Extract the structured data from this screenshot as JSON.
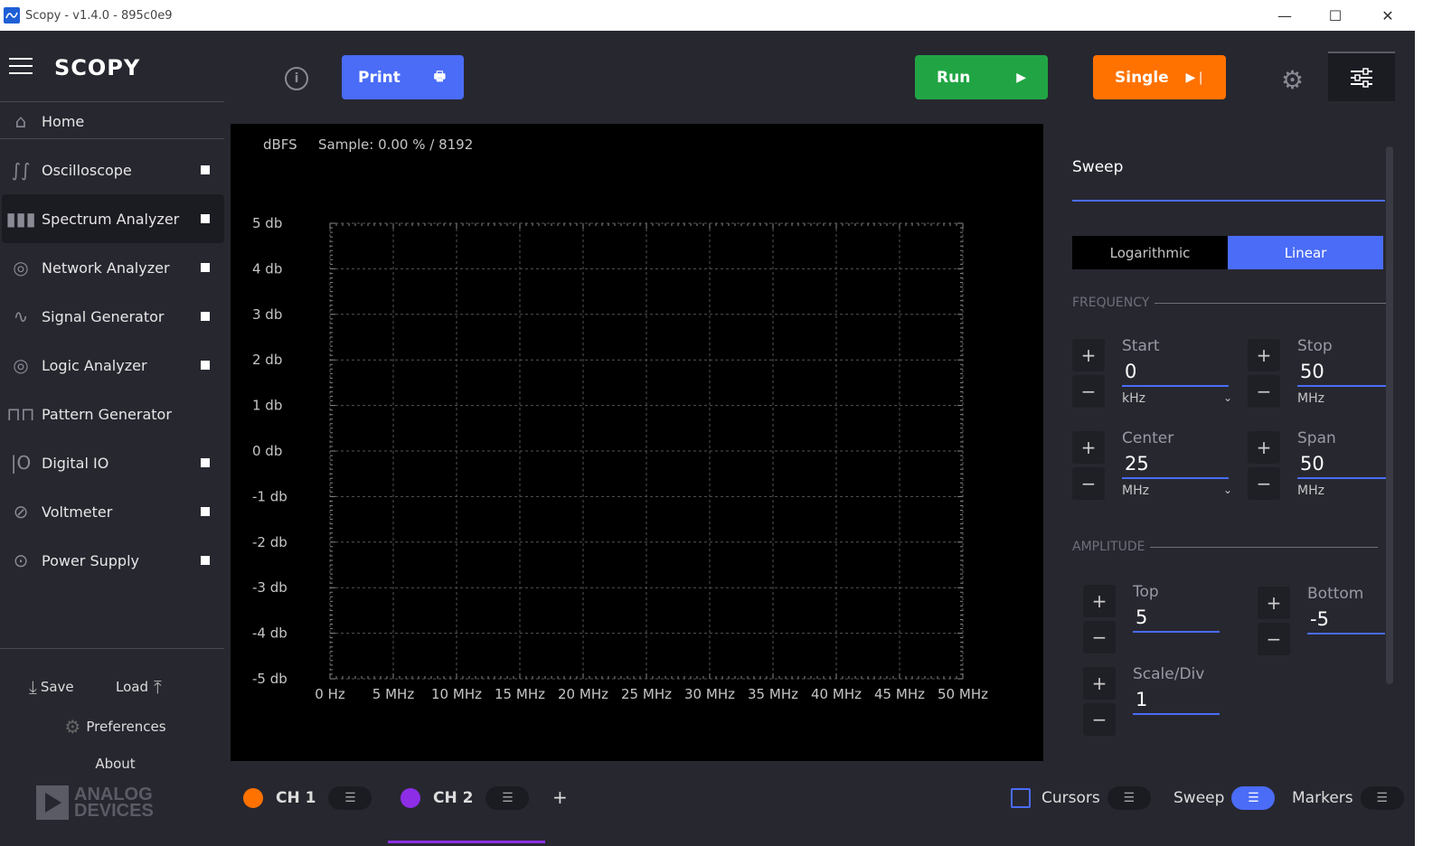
{
  "window": {
    "title": "Scopy - v1.4.0 - 895c0e9",
    "minimize": "—",
    "maximize": "☐",
    "close": "✕"
  },
  "sidebar": {
    "logo": "SCOPY",
    "home": "Home",
    "items": [
      {
        "label": "Oscilloscope",
        "icon": "oscilloscope-icon",
        "glyph": "∫∫",
        "square": true
      },
      {
        "label": "Spectrum Analyzer",
        "icon": "spectrum-icon",
        "glyph": "▮▮▮",
        "square": true,
        "active": true
      },
      {
        "label": "Network Analyzer",
        "icon": "network-icon",
        "glyph": "◎",
        "square": true
      },
      {
        "label": "Signal Generator",
        "icon": "signal-icon",
        "glyph": "∿",
        "square": true
      },
      {
        "label": "Logic Analyzer",
        "icon": "logic-icon",
        "glyph": "◎",
        "square": true
      },
      {
        "label": "Pattern Generator",
        "icon": "pattern-icon",
        "glyph": "⊓⊓",
        "square": false
      },
      {
        "label": "Digital IO",
        "icon": "digital-io-icon",
        "glyph": "|O",
        "square": true
      },
      {
        "label": "Voltmeter",
        "icon": "voltmeter-icon",
        "glyph": "⊘",
        "square": true
      },
      {
        "label": "Power Supply",
        "icon": "power-icon",
        "glyph": "⊙",
        "square": true
      }
    ],
    "save": "Save",
    "load": "Load",
    "preferences": "Preferences",
    "about": "About",
    "brand_line1": "ANALOG",
    "brand_line2": "DEVICES"
  },
  "toolbar": {
    "print": "Print",
    "run": "Run",
    "single": "Single",
    "colors": {
      "print": "#4a6cf7",
      "run": "#21a544",
      "single": "#ff7200"
    }
  },
  "plot": {
    "unit_label": "dBFS",
    "sample_info": "Sample: 0.00 % / 8192",
    "y_ticks": [
      "5 db",
      "4 db",
      "3 db",
      "2 db",
      "1 db",
      "0 db",
      "-1 db",
      "-2 db",
      "-3 db",
      "-4 db",
      "-5 db"
    ],
    "x_ticks": [
      "0 Hz",
      "5 MHz",
      "10 MHz",
      "15 MHz",
      "20 MHz",
      "25 MHz",
      "30 MHz",
      "35 MHz",
      "40 MHz",
      "45 MHz",
      "50 MHz"
    ]
  },
  "panel": {
    "title": "Sweep",
    "scale_log": "Logarithmic",
    "scale_linear": "Linear",
    "frequency_label": "FREQUENCY",
    "amplitude_label": "AMPLITUDE",
    "start": {
      "label": "Start",
      "value": "0",
      "unit": "kHz"
    },
    "stop": {
      "label": "Stop",
      "value": "50",
      "unit": "MHz"
    },
    "center": {
      "label": "Center",
      "value": "25",
      "unit": "MHz"
    },
    "span": {
      "label": "Span",
      "value": "50",
      "unit": "MHz"
    },
    "top": {
      "label": "Top",
      "value": "5"
    },
    "bottom": {
      "label": "Bottom",
      "value": "-5"
    },
    "scale_div": {
      "label": "Scale/Div",
      "value": "1"
    }
  },
  "bottom": {
    "ch1": "CH 1",
    "ch2": "CH 2",
    "add": "+",
    "cursors": "Cursors",
    "sweep": "Sweep",
    "markers": "Markers",
    "colors": {
      "ch1": "#ff7200",
      "ch2": "#8d2ee6"
    }
  }
}
